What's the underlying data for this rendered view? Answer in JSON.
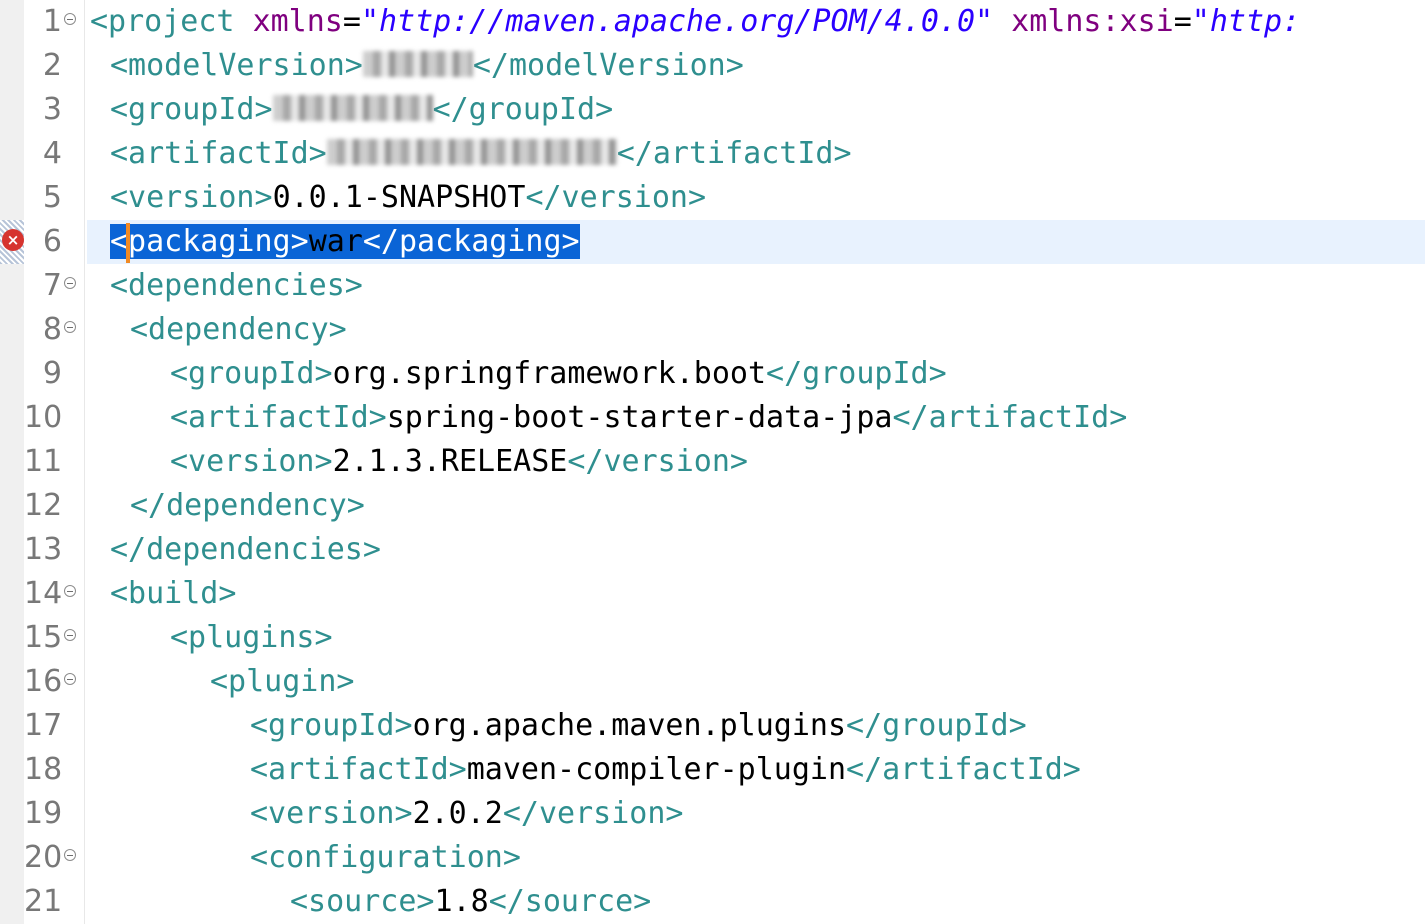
{
  "colors": {
    "tag": "#2f8f8f",
    "attribute": "#7f007f",
    "attribute_value": "#2a00ff",
    "text": "#000000",
    "selection": "#0a64d6",
    "current_line": "#e8f2fe",
    "error_marker": "#d6342f",
    "line_number": "#787878"
  },
  "editor": {
    "error_line": 6,
    "selected_line": 6,
    "lines": [
      {
        "n": "1",
        "fold": true,
        "indent": 0,
        "parts": [
          {
            "c": "t",
            "s": "<project "
          },
          {
            "c": "a",
            "s": "xmlns"
          },
          {
            "c": "tx",
            "s": "="
          },
          {
            "c": "v",
            "s": "\"http://maven.apache.org/POM/4.0.0\""
          },
          {
            "c": "tx",
            "s": " "
          },
          {
            "c": "a",
            "s": "xmlns:xsi"
          },
          {
            "c": "tx",
            "s": "="
          },
          {
            "c": "v",
            "s": "\"http:"
          }
        ]
      },
      {
        "n": "2",
        "fold": false,
        "indent": 1,
        "parts": [
          {
            "c": "t",
            "s": "<modelVersion>"
          },
          {
            "c": "blur",
            "w": 110
          },
          {
            "c": "t",
            "s": "</modelVersion>"
          }
        ]
      },
      {
        "n": "3",
        "fold": false,
        "indent": 1,
        "parts": [
          {
            "c": "t",
            "s": "<groupId>"
          },
          {
            "c": "blur",
            "w": 160
          },
          {
            "c": "t",
            "s": "</groupId>"
          }
        ]
      },
      {
        "n": "4",
        "fold": false,
        "indent": 1,
        "parts": [
          {
            "c": "t",
            "s": "<artifactId>"
          },
          {
            "c": "blur",
            "w": 290
          },
          {
            "c": "t",
            "s": "</artifactId>"
          }
        ]
      },
      {
        "n": "5",
        "fold": false,
        "indent": 1,
        "parts": [
          {
            "c": "t",
            "s": "<version>"
          },
          {
            "c": "tx",
            "s": "0.0.1-SNAPSHOT"
          },
          {
            "c": "t",
            "s": "</version>"
          }
        ]
      },
      {
        "n": "6",
        "fold": false,
        "indent": 1,
        "selected": true,
        "parts": [
          {
            "c": "t",
            "s": "<packaging>"
          },
          {
            "c": "tx",
            "s": "war"
          },
          {
            "c": "t",
            "s": "</packaging>"
          }
        ]
      },
      {
        "n": "7",
        "fold": true,
        "indent": 1,
        "parts": [
          {
            "c": "t",
            "s": "<dependencies>"
          }
        ]
      },
      {
        "n": "8",
        "fold": true,
        "indent": 2,
        "parts": [
          {
            "c": "t",
            "s": "<dependency>"
          }
        ]
      },
      {
        "n": "9",
        "fold": false,
        "indent": 4,
        "parts": [
          {
            "c": "t",
            "s": "<groupId>"
          },
          {
            "c": "tx",
            "s": "org.springframework.boot"
          },
          {
            "c": "t",
            "s": "</groupId>"
          }
        ]
      },
      {
        "n": "10",
        "fold": false,
        "indent": 4,
        "parts": [
          {
            "c": "t",
            "s": "<artifactId>"
          },
          {
            "c": "tx",
            "s": "spring-boot-starter-data-jpa"
          },
          {
            "c": "t",
            "s": "</artifactId>"
          }
        ]
      },
      {
        "n": "11",
        "fold": false,
        "indent": 4,
        "parts": [
          {
            "c": "t",
            "s": "<version>"
          },
          {
            "c": "tx",
            "s": "2.1.3.RELEASE"
          },
          {
            "c": "t",
            "s": "</version>"
          }
        ]
      },
      {
        "n": "12",
        "fold": false,
        "indent": 2,
        "parts": [
          {
            "c": "t",
            "s": "</dependency>"
          }
        ]
      },
      {
        "n": "13",
        "fold": false,
        "indent": 1,
        "parts": [
          {
            "c": "t",
            "s": "</dependencies>"
          }
        ]
      },
      {
        "n": "14",
        "fold": true,
        "indent": 1,
        "parts": [
          {
            "c": "t",
            "s": "<build>"
          }
        ]
      },
      {
        "n": "15",
        "fold": true,
        "indent": 4,
        "parts": [
          {
            "c": "t",
            "s": "<plugins>"
          }
        ]
      },
      {
        "n": "16",
        "fold": true,
        "indent": 6,
        "parts": [
          {
            "c": "t",
            "s": "<plugin>"
          }
        ]
      },
      {
        "n": "17",
        "fold": false,
        "indent": 8,
        "parts": [
          {
            "c": "t",
            "s": "<groupId>"
          },
          {
            "c": "tx",
            "s": "org.apache.maven.plugins"
          },
          {
            "c": "t",
            "s": "</groupId>"
          }
        ]
      },
      {
        "n": "18",
        "fold": false,
        "indent": 8,
        "parts": [
          {
            "c": "t",
            "s": "<artifactId>"
          },
          {
            "c": "tx",
            "s": "maven-compiler-plugin"
          },
          {
            "c": "t",
            "s": "</artifactId>"
          }
        ]
      },
      {
        "n": "19",
        "fold": false,
        "indent": 8,
        "parts": [
          {
            "c": "t",
            "s": "<version>"
          },
          {
            "c": "tx",
            "s": "2.0.2"
          },
          {
            "c": "t",
            "s": "</version>"
          }
        ]
      },
      {
        "n": "20",
        "fold": true,
        "indent": 8,
        "parts": [
          {
            "c": "t",
            "s": "<configuration>"
          }
        ]
      },
      {
        "n": "21",
        "fold": false,
        "indent": 10,
        "parts": [
          {
            "c": "t",
            "s": "<source>"
          },
          {
            "c": "tx",
            "s": "1.8"
          },
          {
            "c": "t",
            "s": "</source>"
          }
        ]
      }
    ]
  }
}
